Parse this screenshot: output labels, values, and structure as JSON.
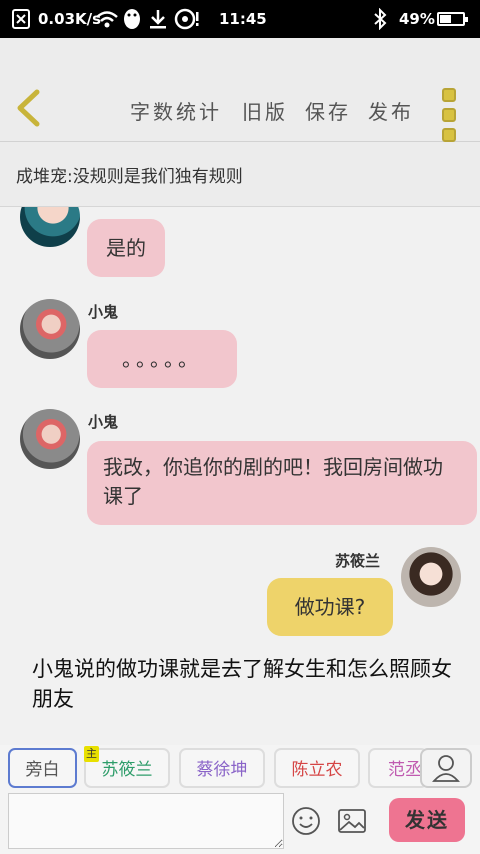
{
  "status_bar": {
    "net_speed": "0.03K/s",
    "time": "11:45",
    "battery": "49%",
    "battery_level": 0.49,
    "icons": [
      "close-box-icon",
      "wifi-icon",
      "penguin-icon",
      "download-icon",
      "sync-icon",
      "bluetooth-icon",
      "battery-icon"
    ]
  },
  "header": {
    "word_count": "字数统计",
    "old_version": "旧版",
    "save": "保存",
    "publish": "发布"
  },
  "rule_bar": {
    "text": "成堆宠:没规则是我们独有规则"
  },
  "messages": [
    {
      "side": "left",
      "sender": "",
      "text": "是的",
      "avatar": "teal-avatar"
    },
    {
      "side": "left",
      "sender": "小鬼",
      "text": "。。。。。",
      "avatar": "pink-hair-avatar"
    },
    {
      "side": "left",
      "sender": "小鬼",
      "text": "我改，你追你的剧的吧！我回房间做功课了",
      "avatar": "pink-hair-avatar"
    },
    {
      "side": "right",
      "sender": "苏筱兰",
      "text": "做功课?",
      "avatar": "girl-avatar"
    }
  ],
  "narration": "小鬼说的做功课就是去了解女生和怎么照顾女朋友",
  "roles": {
    "me": "旁白",
    "crown": "主",
    "list": [
      "苏筱兰",
      "蔡徐坤",
      "陈立农",
      "范丞"
    ],
    "colors": [
      "#2e9d6a",
      "#8a64c8",
      "#d54545",
      "#c05ab0"
    ]
  },
  "input": {
    "placeholder": "",
    "send": "发送"
  }
}
